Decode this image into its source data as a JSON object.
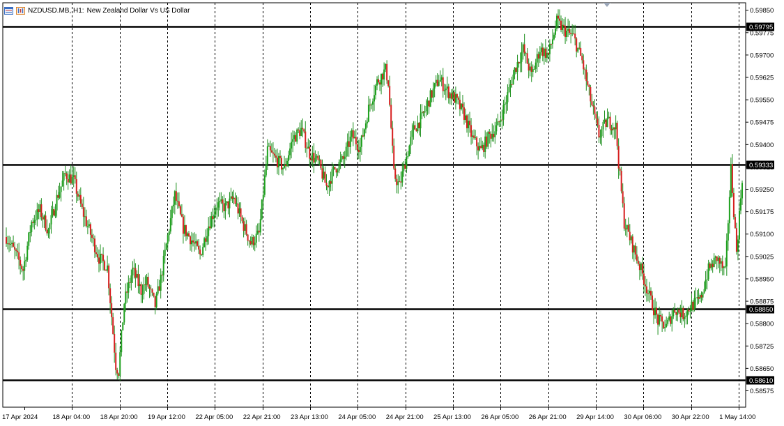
{
  "window": {
    "symbol_title": "NZDUSD.MB, H1:",
    "description": "New Zealand Dollar Vs US Dollar"
  },
  "colors": {
    "bull": "#1ea01e",
    "bear": "#d61f1f",
    "wick": "#1e8f1e",
    "grid": "#000000",
    "hline": "#000000",
    "background": "#ffffff"
  },
  "icons": [
    "chart-window-icon",
    "chart-properties-icon"
  ],
  "chart_data": {
    "type": "candlestick",
    "timeframe": "H1",
    "y_range": [
      0.5852,
      0.59875
    ],
    "y_ticks": [
      "0.59850",
      "0.59775",
      "0.59700",
      "0.59625",
      "0.59550",
      "0.59475",
      "0.59400",
      "0.59325",
      "0.59250",
      "0.59175",
      "0.59100",
      "0.59025",
      "0.58950",
      "0.58875",
      "0.58800",
      "0.58725",
      "0.58650",
      "0.58575"
    ],
    "x_labels": [
      "17 Apr 2024",
      "18 Apr 04:00",
      "18 Apr 20:00",
      "19 Apr 12:00",
      "22 Apr 05:00",
      "22 Apr 21:00",
      "23 Apr 13:00",
      "24 Apr 05:00",
      "24 Apr 21:00",
      "25 Apr 13:00",
      "26 Apr 05:00",
      "26 Apr 21:00",
      "29 Apr 14:00",
      "30 Apr 06:00",
      "30 Apr 22:00",
      "1 May 14:00"
    ],
    "horizontal_lines": [
      "0.59795",
      "0.59333",
      "0.58850",
      "0.58610"
    ],
    "vertical_grid_lines": 12,
    "price_path": [
      [
        0,
        0.5909
      ],
      [
        6,
        0.5904
      ],
      [
        12,
        0.5898
      ],
      [
        18,
        0.5914
      ],
      [
        24,
        0.5918
      ],
      [
        30,
        0.5911
      ],
      [
        36,
        0.5922
      ],
      [
        42,
        0.593
      ],
      [
        48,
        0.5928
      ],
      [
        54,
        0.5918
      ],
      [
        60,
        0.591
      ],
      [
        66,
        0.5902
      ],
      [
        72,
        0.5899
      ],
      [
        78,
        0.5866
      ],
      [
        80,
        0.5864
      ],
      [
        84,
        0.5887
      ],
      [
        90,
        0.5898
      ],
      [
        96,
        0.5891
      ],
      [
        100,
        0.5894
      ],
      [
        106,
        0.5886
      ],
      [
        110,
        0.5895
      ],
      [
        116,
        0.5912
      ],
      [
        120,
        0.5923
      ],
      [
        126,
        0.5912
      ],
      [
        132,
        0.5908
      ],
      [
        138,
        0.5903
      ],
      [
        144,
        0.5913
      ],
      [
        150,
        0.592
      ],
      [
        156,
        0.5919
      ],
      [
        162,
        0.5922
      ],
      [
        168,
        0.5914
      ],
      [
        174,
        0.5907
      ],
      [
        180,
        0.591
      ],
      [
        186,
        0.5938
      ],
      [
        192,
        0.5935
      ],
      [
        198,
        0.5932
      ],
      [
        204,
        0.5942
      ],
      [
        210,
        0.5945
      ],
      [
        216,
        0.5937
      ],
      [
        222,
        0.5934
      ],
      [
        228,
        0.5926
      ],
      [
        234,
        0.5932
      ],
      [
        240,
        0.5935
      ],
      [
        246,
        0.5943
      ],
      [
        252,
        0.5939
      ],
      [
        258,
        0.5952
      ],
      [
        264,
        0.5961
      ],
      [
        270,
        0.5965
      ],
      [
        272,
        0.5961
      ],
      [
        276,
        0.593
      ],
      [
        280,
        0.5926
      ],
      [
        284,
        0.5934
      ],
      [
        290,
        0.5945
      ],
      [
        296,
        0.5949
      ],
      [
        302,
        0.5956
      ],
      [
        308,
        0.5962
      ],
      [
        314,
        0.5958
      ],
      [
        320,
        0.5955
      ],
      [
        326,
        0.595
      ],
      [
        332,
        0.5942
      ],
      [
        338,
        0.5938
      ],
      [
        344,
        0.5943
      ],
      [
        350,
        0.5946
      ],
      [
        356,
        0.5955
      ],
      [
        362,
        0.5965
      ],
      [
        368,
        0.5972
      ],
      [
        374,
        0.5963
      ],
      [
        380,
        0.5972
      ],
      [
        386,
        0.597
      ],
      [
        392,
        0.5981
      ],
      [
        398,
        0.5978
      ],
      [
        404,
        0.5976
      ],
      [
        410,
        0.5968
      ],
      [
        416,
        0.5955
      ],
      [
        422,
        0.5943
      ],
      [
        428,
        0.5948
      ],
      [
        434,
        0.5946
      ],
      [
        436,
        0.5934
      ],
      [
        440,
        0.5914
      ],
      [
        446,
        0.5906
      ],
      [
        452,
        0.5898
      ],
      [
        458,
        0.5889
      ],
      [
        464,
        0.5881
      ],
      [
        470,
        0.5879
      ],
      [
        476,
        0.5885
      ],
      [
        482,
        0.5883
      ],
      [
        488,
        0.5886
      ],
      [
        494,
        0.5888
      ],
      [
        500,
        0.5898
      ],
      [
        506,
        0.5902
      ],
      [
        512,
        0.5897
      ],
      [
        516,
        0.5932
      ],
      [
        520,
        0.5904
      ],
      [
        524,
        0.5929
      ]
    ]
  }
}
